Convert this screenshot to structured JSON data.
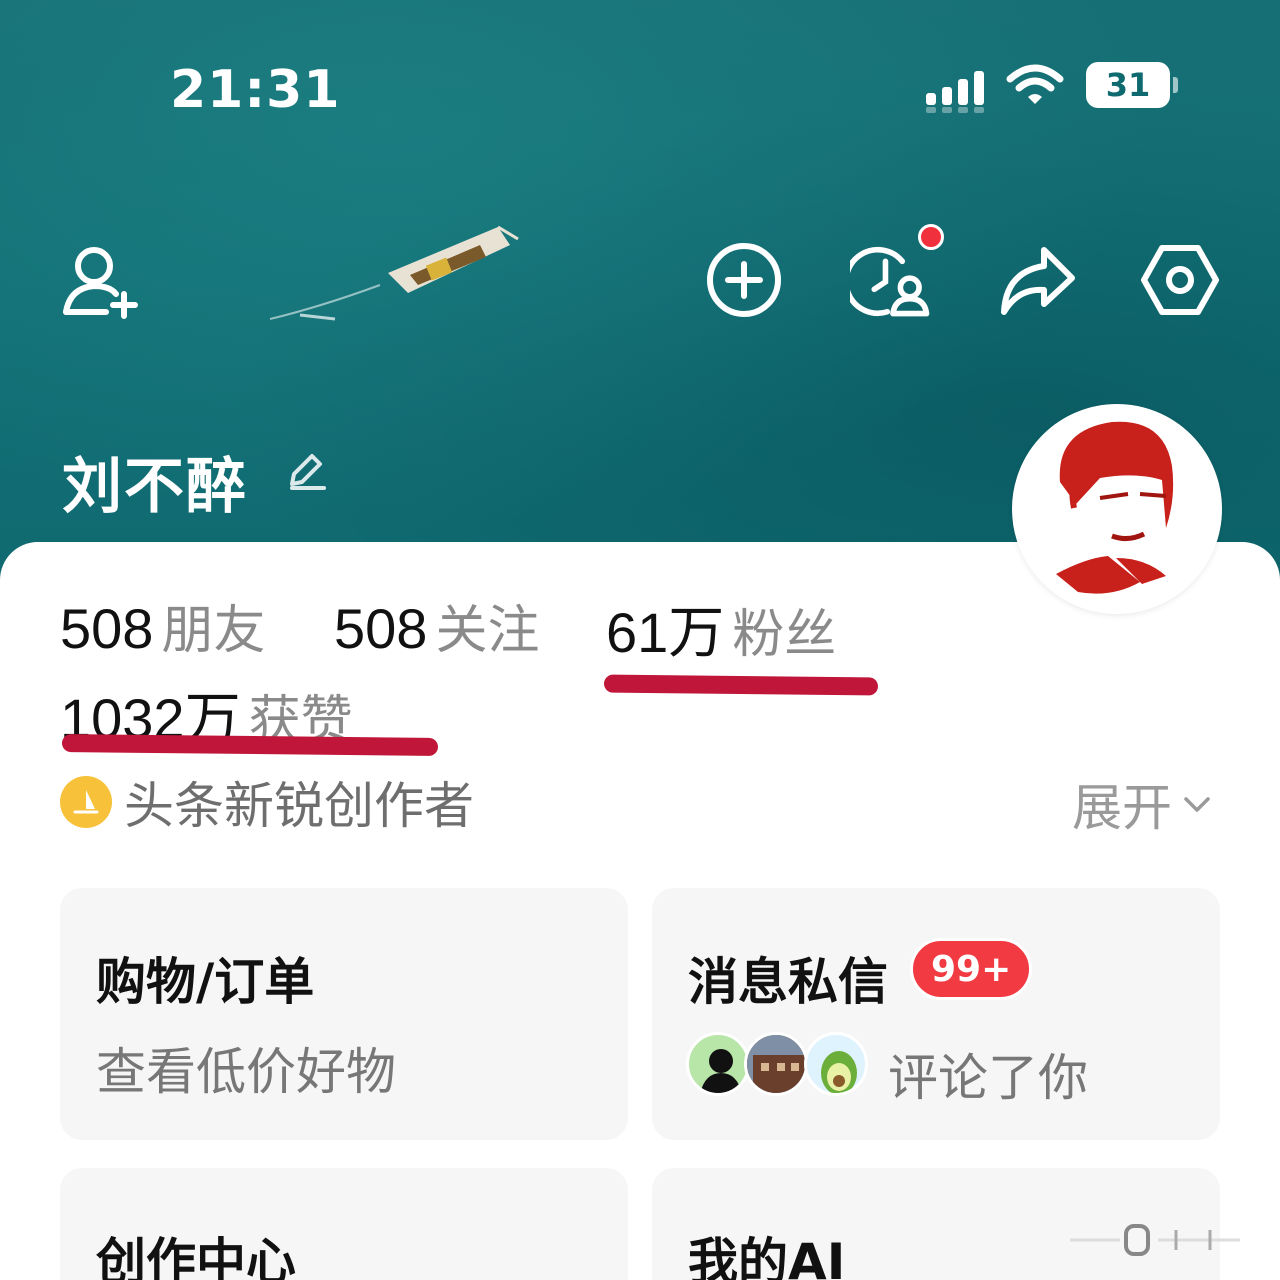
{
  "status_bar": {
    "time": "21:31",
    "battery_level": "31",
    "icons": [
      "signal-icon",
      "wifi-icon",
      "battery-icon"
    ]
  },
  "header": {
    "icons": [
      "add-friend-icon",
      "add-icon",
      "history-icon",
      "share-icon",
      "settings-icon"
    ],
    "notification_dot_color": "#f0303c"
  },
  "profile": {
    "name": "刘不醉",
    "edit_icon": "edit-icon",
    "stats": {
      "friends_count": "508",
      "friends_label": "朋友",
      "following_count": "508",
      "following_label": "关注",
      "followers_count": "61万",
      "followers_label": "粉丝",
      "likes_count": "1032万",
      "likes_label": "获赞"
    },
    "badge": "头条新锐创作者",
    "expand_label": "展开"
  },
  "panels": {
    "shopping": {
      "title": "购物/订单",
      "subtitle": "查看低价好物"
    },
    "messages": {
      "title": "消息私信",
      "badge": "99+",
      "subtitle": "评论了你"
    },
    "creator": {
      "title": "创作中心"
    },
    "ai": {
      "title": "我的AI"
    }
  },
  "colors": {
    "hero_bg": "#127076",
    "accent_red": "#f23a43",
    "underline": "#c0163a",
    "badge_gold": "#f7c23a"
  }
}
